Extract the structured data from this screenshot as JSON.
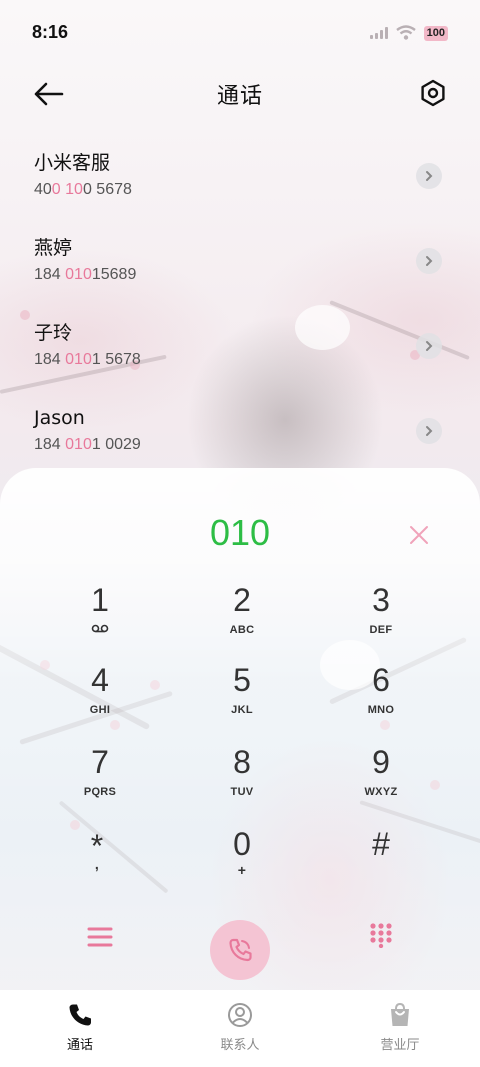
{
  "status_bar": {
    "time": "8:16",
    "battery": "100",
    "icons": [
      "signal-icon",
      "wifi-icon",
      "battery-icon"
    ]
  },
  "header": {
    "title": "通话",
    "back_icon": "back-arrow-icon",
    "settings_icon": "settings-hex-icon"
  },
  "contacts": [
    {
      "name": "小米客服",
      "number": [
        {
          "t": "40",
          "hl": false
        },
        {
          "t": "0",
          "hl": true
        },
        {
          "t": " ",
          "hl": false
        },
        {
          "t": "10",
          "hl": true
        },
        {
          "t": "0 5678",
          "hl": false
        }
      ]
    },
    {
      "name": "燕婷",
      "number": [
        {
          "t": "184 ",
          "hl": false
        },
        {
          "t": "010",
          "hl": true
        },
        {
          "t": "15689",
          "hl": false
        }
      ]
    },
    {
      "name": "子玲",
      "number": [
        {
          "t": "184 ",
          "hl": false
        },
        {
          "t": "010",
          "hl": true
        },
        {
          "t": "1 5678",
          "hl": false
        }
      ]
    },
    {
      "name": "Jason",
      "number": [
        {
          "t": "184 ",
          "hl": false
        },
        {
          "t": "010",
          "hl": true
        },
        {
          "t": "1 0029",
          "hl": false
        }
      ]
    }
  ],
  "dialpad": {
    "entered_number": "010",
    "keys": [
      {
        "digit": "1",
        "letters": "voicemail-icon"
      },
      {
        "digit": "2",
        "letters": "ABC"
      },
      {
        "digit": "3",
        "letters": "DEF"
      },
      {
        "digit": "4",
        "letters": "GHI"
      },
      {
        "digit": "5",
        "letters": "JKL"
      },
      {
        "digit": "6",
        "letters": "MNO"
      },
      {
        "digit": "7",
        "letters": "PQRS"
      },
      {
        "digit": "8",
        "letters": "TUV"
      },
      {
        "digit": "9",
        "letters": "WXYZ"
      },
      {
        "digit": "*",
        "letters": ","
      },
      {
        "digit": "0",
        "letters": "+"
      },
      {
        "digit": "#",
        "letters": ""
      }
    ]
  },
  "bottom_nav": [
    {
      "label": "通话",
      "icon": "phone-icon",
      "active": true
    },
    {
      "label": "联系人",
      "icon": "contact-icon",
      "active": false
    },
    {
      "label": "营业厅",
      "icon": "shopping-bag-icon",
      "active": false
    }
  ],
  "colors": {
    "accent_pink": "#e8799b",
    "entered_green": "#2dbd45",
    "call_button": "#f4c4d3"
  }
}
